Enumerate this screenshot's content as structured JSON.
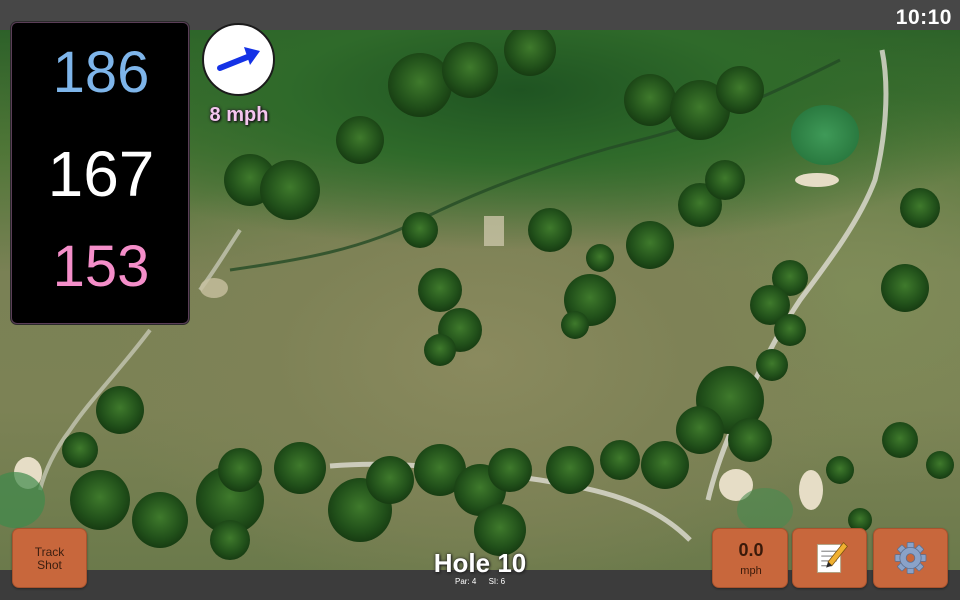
{
  "status": {
    "time": "10:10"
  },
  "distances": {
    "back": "186",
    "middle": "167",
    "front": "153"
  },
  "wind": {
    "speed_label": "8 mph",
    "icon": "wind-direction-arrow-icon"
  },
  "hole": {
    "title": "Hole 10",
    "par_label": "Par: 4",
    "si_label": "SI: 6"
  },
  "buttons": {
    "track_shot_line1": "Track",
    "track_shot_line2": "Shot",
    "speed_value": "0.0",
    "speed_unit": "mph",
    "notes_icon": "memo-icon",
    "settings_icon": "gear-icon"
  },
  "colors": {
    "back_distance": "#7eb5ea",
    "middle_distance": "#ffffff",
    "front_distance": "#f48ec9",
    "button": "#c8673c",
    "wind_text": "#f4c6ee"
  }
}
